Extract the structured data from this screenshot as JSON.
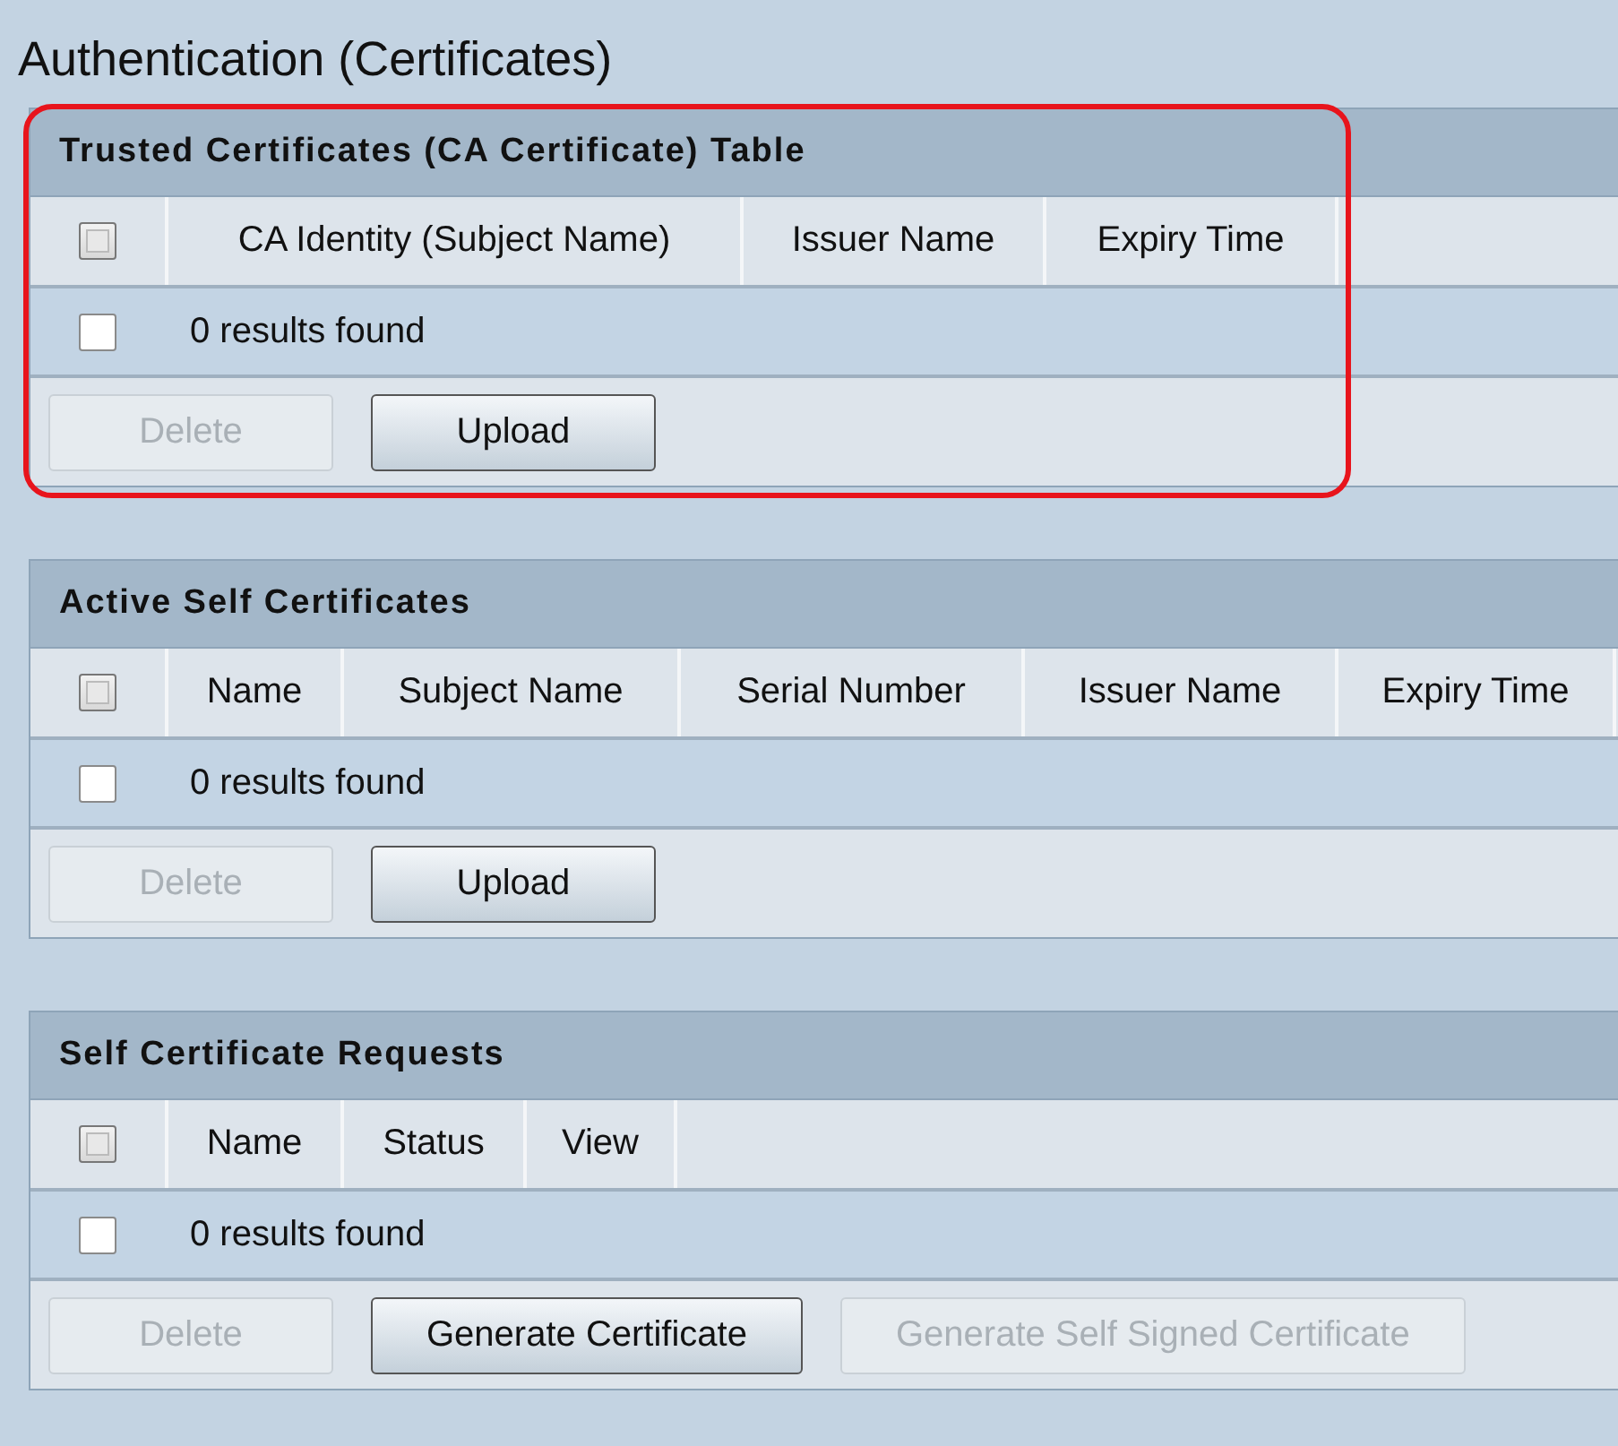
{
  "page_title": "Authentication (Certificates)",
  "sections": [
    {
      "title": "Trusted Certificates (CA Certificate) Table",
      "highlighted": true,
      "select_all": {
        "checked": false,
        "disabled": true
      },
      "columns": [
        "CA Identity (Subject Name)",
        "Issuer Name",
        "Expiry Time"
      ],
      "row": {
        "checked": false,
        "disabled": false,
        "text": "0 results found"
      },
      "buttons": [
        {
          "label": "Delete",
          "disabled": true
        },
        {
          "label": "Upload",
          "disabled": false
        }
      ]
    },
    {
      "title": "Active Self Certificates",
      "highlighted": false,
      "select_all": {
        "checked": false,
        "disabled": true
      },
      "columns": [
        "Name",
        "Subject Name",
        "Serial Number",
        "Issuer Name",
        "Expiry Time"
      ],
      "row": {
        "checked": false,
        "disabled": false,
        "text": "0 results found"
      },
      "buttons": [
        {
          "label": "Delete",
          "disabled": true
        },
        {
          "label": "Upload",
          "disabled": false
        }
      ]
    },
    {
      "title": "Self Certificate Requests",
      "highlighted": false,
      "select_all": {
        "checked": false,
        "disabled": true
      },
      "columns": [
        "Name",
        "Status",
        "View"
      ],
      "row": {
        "checked": false,
        "disabled": false,
        "text": "0 results found"
      },
      "buttons": [
        {
          "label": "Delete",
          "disabled": true
        },
        {
          "label": "Generate Certificate",
          "disabled": false
        },
        {
          "label": "Generate Self Signed Certificate",
          "disabled": true
        }
      ]
    }
  ]
}
